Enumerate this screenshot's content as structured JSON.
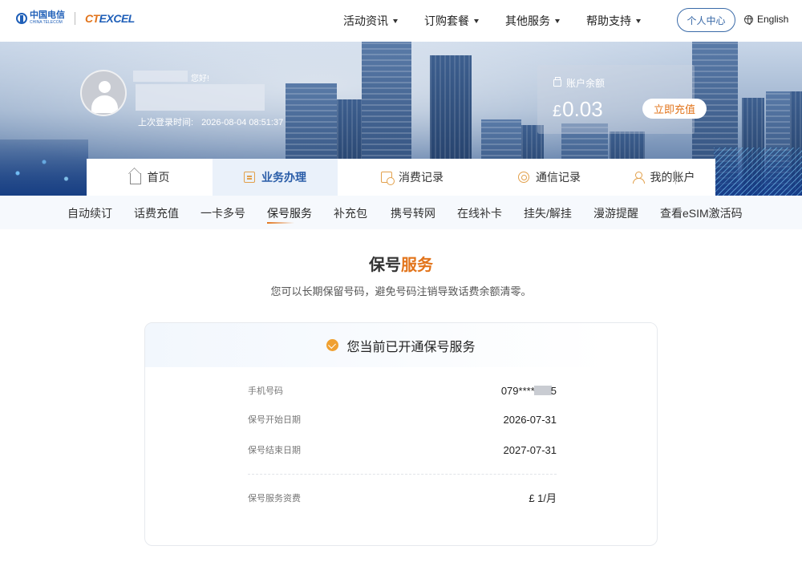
{
  "header": {
    "logo_ct_text": "中国电信",
    "logo_ct_sub": "CHINA TELECOM",
    "logo_tex_prefix": "CT",
    "logo_tex_suffix": "EXCEL",
    "nav": [
      {
        "label": "活动资讯"
      },
      {
        "label": "订购套餐"
      },
      {
        "label": "其他服务"
      },
      {
        "label": "帮助支持"
      }
    ],
    "personal_center": "个人中心",
    "language": "English"
  },
  "user": {
    "greeting": "您好!",
    "last_login_label": "上次登录时间:",
    "last_login_time": "2026-08-04 08:51:37"
  },
  "balance": {
    "label": "账户余额",
    "currency": "£",
    "amount": "0.03",
    "recharge": "立即充值"
  },
  "tabs": [
    {
      "label": "首页",
      "icon": "home-icon"
    },
    {
      "label": "业务办理",
      "icon": "document-icon",
      "active": true
    },
    {
      "label": "消费记录",
      "icon": "clock-icon"
    },
    {
      "label": "通信记录",
      "icon": "signal-icon"
    },
    {
      "label": "我的账户",
      "icon": "user-icon"
    }
  ],
  "subnav": [
    {
      "label": "自动续订"
    },
    {
      "label": "话费充值"
    },
    {
      "label": "一卡多号"
    },
    {
      "label": "保号服务",
      "active": true
    },
    {
      "label": "补充包"
    },
    {
      "label": "携号转网"
    },
    {
      "label": "在线补卡"
    },
    {
      "label": "挂失/解挂"
    },
    {
      "label": "漫游提醒"
    },
    {
      "label": "查看eSIM激活码"
    }
  ],
  "page": {
    "title_main": "保号",
    "title_accent": "服务",
    "description": "您可以长期保留号码，避免号码注销导致话费余额清零。"
  },
  "card": {
    "title": "您当前已开通保号服务",
    "rows": [
      {
        "label": "手机号码",
        "value_prefix": "079****",
        "value_suffix": "5"
      },
      {
        "label": "保号开始日期",
        "value": "2026-07-31"
      },
      {
        "label": "保号结束日期",
        "value": "2027-07-31"
      },
      {
        "label": "保号服务资费",
        "value": "£ 1/月"
      }
    ]
  }
}
